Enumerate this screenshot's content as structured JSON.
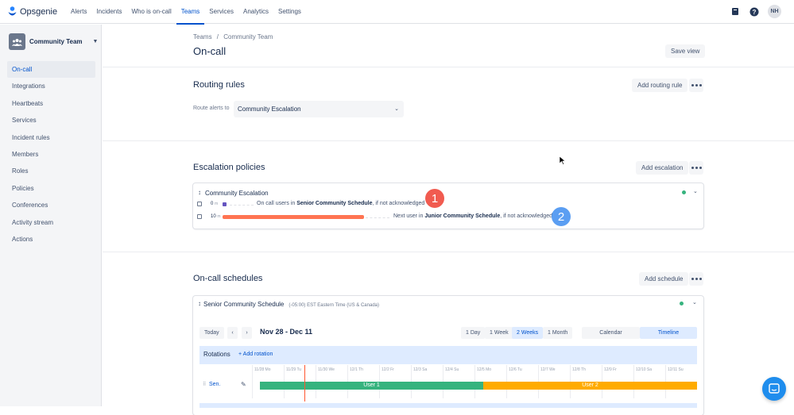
{
  "app": {
    "name": "Opsgenie"
  },
  "nav": {
    "items": [
      {
        "label": "Alerts"
      },
      {
        "label": "Incidents"
      },
      {
        "label": "Who is on-call"
      },
      {
        "label": "Teams",
        "active": true
      },
      {
        "label": "Services"
      },
      {
        "label": "Analytics"
      },
      {
        "label": "Settings"
      }
    ]
  },
  "user": {
    "initials": "NH"
  },
  "sidebar": {
    "team_name": "Community Team",
    "items": [
      {
        "label": "On-call",
        "active": true
      },
      {
        "label": "Integrations"
      },
      {
        "label": "Heartbeats"
      },
      {
        "label": "Services"
      },
      {
        "label": "Incident rules"
      },
      {
        "label": "Members"
      },
      {
        "label": "Roles"
      },
      {
        "label": "Policies"
      },
      {
        "label": "Conferences"
      },
      {
        "label": "Activity stream"
      },
      {
        "label": "Actions"
      }
    ]
  },
  "breadcrumb": {
    "root": "Teams",
    "sep": "/",
    "current": "Community Team"
  },
  "page": {
    "title": "On-call",
    "save_view": "Save view"
  },
  "routing": {
    "title": "Routing rules",
    "add_button": "Add routing rule",
    "route_label": "Route alerts to",
    "route_value": "Community Escalation"
  },
  "escalation": {
    "title": "Escalation policies",
    "add_button": "Add escalation",
    "policy_name": "Community Escalation",
    "rows": [
      {
        "time": "0",
        "unit": "m",
        "prefix": "On call users in",
        "target": "Senior Community Schedule",
        "suffix": ", if not acknowledged",
        "badge": "1"
      },
      {
        "time": "10",
        "unit": "m",
        "prefix": "Next user in",
        "target": "Junior Community Schedule",
        "suffix": ", if not acknowledged",
        "badge": "2"
      }
    ],
    "badge_colors": [
      "#f15b50",
      "#5b9ef2"
    ]
  },
  "schedules": {
    "title": "On-call schedules",
    "add_button": "Add schedule",
    "schedule_name": "Senior Community Schedule",
    "timezone": "(-05:00) EST Eastern Time (US & Canada)",
    "today": "Today",
    "prev": "‹",
    "next": "›",
    "range": "Nov 28 - Dec 11",
    "periods": [
      {
        "label": "1 Day"
      },
      {
        "label": "1 Week"
      },
      {
        "label": "2 Weeks",
        "selected": true
      },
      {
        "label": "1 Month"
      }
    ],
    "views": [
      {
        "label": "Calendar"
      },
      {
        "label": "Timeline",
        "selected": true
      }
    ],
    "rotations_label": "Rotations",
    "add_rotation": "+ Add rotation",
    "days": [
      "11/28 Mo",
      "11/29 Tu",
      "11/30 We",
      "12/1 Th",
      "12/2 Fr",
      "12/3 Sa",
      "12/4 Su",
      "12/5 Mo",
      "12/6 Tu",
      "12/7 We",
      "12/8 Th",
      "12/9 Fr",
      "12/10 Sa",
      "12/11 Su"
    ],
    "rotation_name": "Sen.",
    "users": [
      {
        "label": "User 1",
        "color": "#36b37e"
      },
      {
        "label": "User 2",
        "color": "#ffab00"
      }
    ]
  }
}
